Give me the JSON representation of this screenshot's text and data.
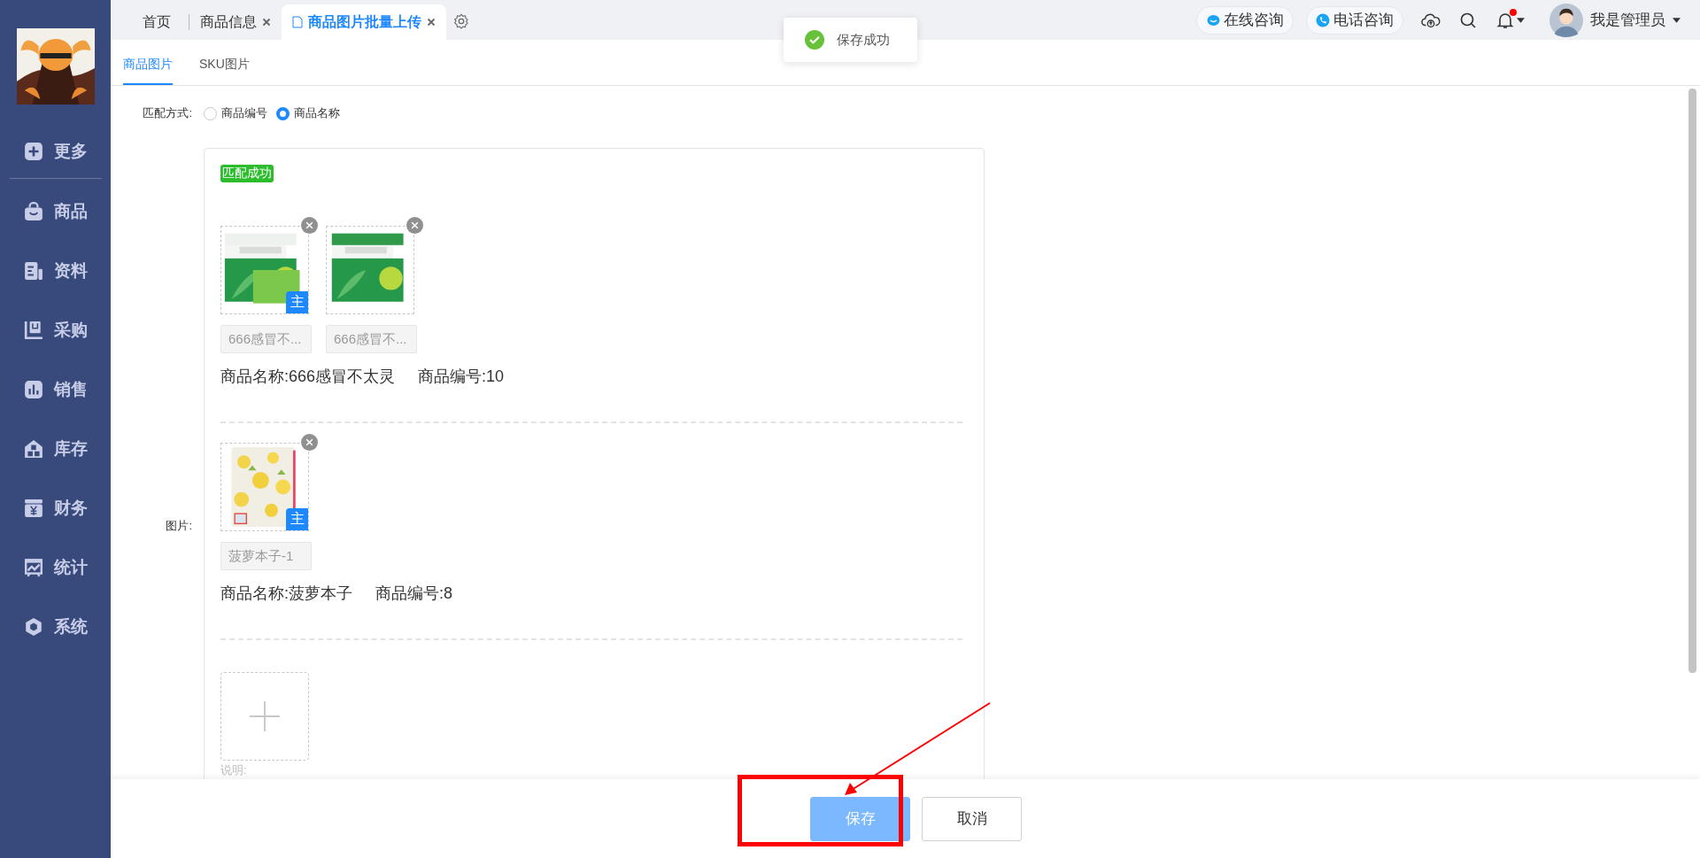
{
  "sidebar": {
    "items": [
      {
        "label": "更多"
      },
      {
        "label": "商品"
      },
      {
        "label": "资料"
      },
      {
        "label": "采购"
      },
      {
        "label": "销售"
      },
      {
        "label": "库存"
      },
      {
        "label": "财务"
      },
      {
        "label": "统计"
      },
      {
        "label": "系统"
      }
    ]
  },
  "tabs": [
    {
      "label": "首页",
      "selected": false,
      "closable": false
    },
    {
      "label": "商品信息",
      "selected": false,
      "closable": true
    },
    {
      "label": "商品图片批量上传",
      "selected": true,
      "closable": true
    }
  ],
  "top_actions": [
    {
      "label": "在线咨询"
    },
    {
      "label": "电话咨询"
    }
  ],
  "notifications": {
    "unread": true
  },
  "user": {
    "name": "我是管理员"
  },
  "toast": {
    "message": "保存成功"
  },
  "subtabs": [
    {
      "label": "商品图片",
      "selected": true
    },
    {
      "label": "SKU图片",
      "selected": false
    }
  ],
  "match": {
    "label": "匹配方式:",
    "options": [
      {
        "label": "商品编号",
        "selected": false
      },
      {
        "label": "商品名称",
        "selected": true
      }
    ]
  },
  "pictures": {
    "label": "图片:",
    "status": "匹配成功",
    "groups": [
      {
        "images": [
          {
            "caption": "666感冒不...",
            "badge": "主"
          },
          {
            "caption": "666感冒不..."
          }
        ],
        "name": "商品名称:666感冒不太灵",
        "code": "商品编号:10"
      },
      {
        "images": [
          {
            "caption": "菠萝本子-1",
            "badge": "主"
          }
        ],
        "name": "商品名称:菠萝本子",
        "code": "商品编号:8"
      }
    ],
    "note": "说明:"
  },
  "footer": {
    "buttons": [
      {
        "label": "保存",
        "kind": "primary"
      },
      {
        "label": "取消",
        "kind": "default"
      }
    ]
  }
}
